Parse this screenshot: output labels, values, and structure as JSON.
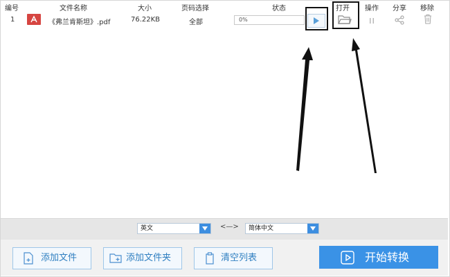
{
  "table": {
    "headers": {
      "index": "编号",
      "filename": "文件名称",
      "size": "大小",
      "pages": "页码选择",
      "status": "状态",
      "open": "打开",
      "operate": "操作",
      "share": "分享",
      "remove": "移除"
    },
    "rows": [
      {
        "index": "1",
        "filename": "《弗兰肯斯坦》.pdf",
        "size": "76.22KB",
        "pages": "全部",
        "progress_text": "0%",
        "progress_fraction": 0
      }
    ]
  },
  "language": {
    "source": "英文",
    "swap_symbol": "<—>",
    "target": "简体中文"
  },
  "toolbar": {
    "add_file": "添加文件",
    "add_folder": "添加文件夹",
    "clear_list": "清空列表",
    "start": "开始转换"
  },
  "colors": {
    "accent": "#3a92e6",
    "pdf_red": "#d64541"
  },
  "icons": {
    "pdf": "pdf-icon",
    "play": "play-icon",
    "open": "folder-open-icon",
    "pause": "pause-icon",
    "share": "share-icon",
    "remove": "trash-icon"
  }
}
